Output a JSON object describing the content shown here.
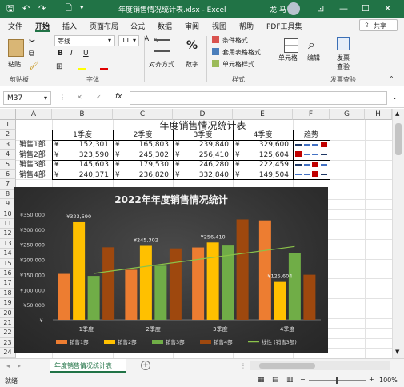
{
  "window": {
    "title": "年度销售情况统计表.xlsx  -  Excel",
    "user": "龙 马"
  },
  "tabs": [
    "文件",
    "开始",
    "插入",
    "页面布局",
    "公式",
    "数据",
    "审阅",
    "视图",
    "帮助",
    "PDF工具集"
  ],
  "active_tab": "开始",
  "share_label": "共享",
  "ribbon": {
    "clipboard": {
      "paste": "粘贴",
      "group": "剪贴板"
    },
    "font": {
      "name": "等线",
      "size": "11",
      "group": "字体",
      "bold": "B",
      "italic": "I",
      "underline": "U",
      "grow": "A",
      "shrink": "A"
    },
    "alignment": {
      "label": "对齐方式"
    },
    "number": {
      "percent": "%",
      "label": "数字"
    },
    "styles": {
      "conditional": "条件格式",
      "table": "套用表格格式",
      "cell_styles": "单元格样式",
      "group": "样式"
    },
    "cells": {
      "label": "单元格"
    },
    "editing": {
      "label": "编辑"
    },
    "invoice": {
      "label1": "发票",
      "label2": "查验",
      "group": "发票查验"
    }
  },
  "formula_bar": {
    "name_box": "M37",
    "fx": "fx",
    "cancel": "✕",
    "enter": "✓"
  },
  "columns": [
    "A",
    "B",
    "C",
    "D",
    "E",
    "F",
    "G",
    "H"
  ],
  "rows": [
    "1",
    "2",
    "3",
    "4",
    "5",
    "6",
    "7",
    "8",
    "9",
    "10",
    "11",
    "12",
    "13",
    "14",
    "15",
    "16",
    "17",
    "18",
    "19",
    "20",
    "21",
    "22",
    "23",
    "24"
  ],
  "table": {
    "title": "年度销售情况统计表",
    "headers": [
      "1季度",
      "2季度",
      "3季度",
      "4季度",
      "趋势"
    ],
    "currency": "¥",
    "data": [
      {
        "dept": "销售1部",
        "q": [
          "152,301",
          "165,803",
          "239,840",
          "329,600"
        ]
      },
      {
        "dept": "销售2部",
        "q": [
          "323,590",
          "245,302",
          "256,410",
          "125,604"
        ]
      },
      {
        "dept": "销售3部",
        "q": [
          "145,603",
          "179,530",
          "246,280",
          "222,459"
        ]
      },
      {
        "dept": "销售4部",
        "q": [
          "240,371",
          "236,820",
          "332,840",
          "149,504"
        ]
      }
    ]
  },
  "colors": {
    "excel_green": "#217346",
    "s1": "#ed7d31",
    "s2": "#ffc000",
    "s3": "#70ad47",
    "s4": "#9e480e",
    "trend": "#8bc34a"
  },
  "chart_data": {
    "type": "bar",
    "title": "2022年年度销售情况统计",
    "categories": [
      "1季度",
      "2季度",
      "3季度",
      "4季度"
    ],
    "series": [
      {
        "name": "销售1部",
        "values": [
          152301,
          165803,
          239840,
          329600
        ]
      },
      {
        "name": "销售2部",
        "values": [
          323590,
          245302,
          256410,
          125604
        ]
      },
      {
        "name": "销售3部",
        "values": [
          145603,
          179530,
          246280,
          222459
        ]
      },
      {
        "name": "销售4部",
        "values": [
          240371,
          236820,
          332840,
          149504
        ]
      }
    ],
    "trendline": {
      "name": "线性 (销售3部)",
      "of": "销售3部",
      "type": "linear"
    },
    "data_labels": [
      {
        "series": "销售2部",
        "category": "1季度",
        "text": "¥323,590"
      },
      {
        "series": "销售2部",
        "category": "2季度",
        "text": "¥245,302"
      },
      {
        "series": "销售2部",
        "category": "3季度",
        "text": "¥256,410"
      },
      {
        "series": "销售2部",
        "category": "4季度",
        "text": "¥125,604"
      }
    ],
    "yticks": [
      "¥-",
      "¥50,000",
      "¥100,000",
      "¥150,000",
      "¥200,000",
      "¥250,000",
      "¥300,000",
      "¥350,000"
    ],
    "ylim": [
      0,
      350000
    ],
    "legend": "bottom",
    "grid": false
  },
  "sheet": {
    "name": "年度销售情况统计表",
    "add": "+"
  },
  "status": {
    "ready": "就绪",
    "zoom": "100%"
  }
}
